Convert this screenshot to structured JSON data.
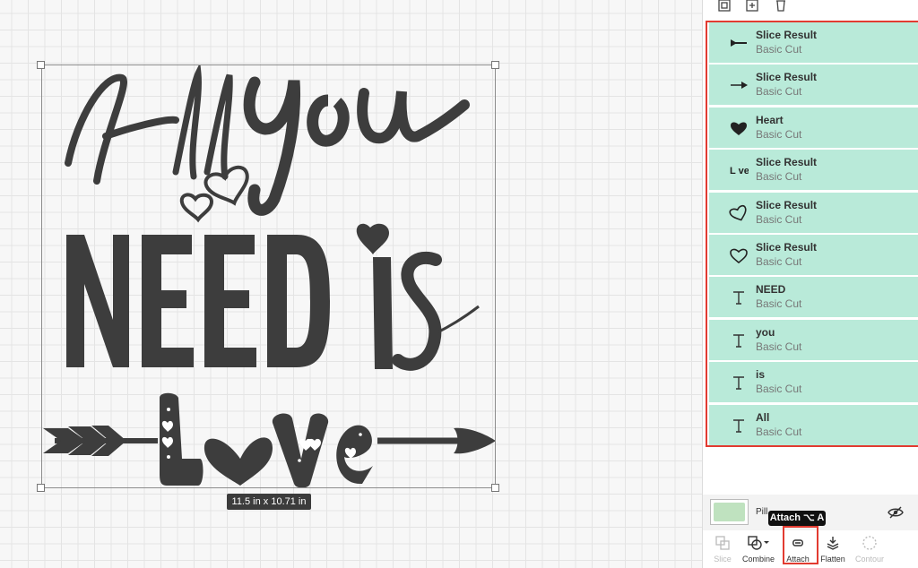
{
  "canvas": {
    "size_label": "11.5  in x 10.71  in"
  },
  "panel": {
    "top_tools": [
      {
        "icon": "group-icon"
      },
      {
        "icon": "duplicate-icon"
      },
      {
        "icon": "trash-icon"
      }
    ],
    "layers": [
      {
        "name": "Slice Result",
        "sub": "Basic Cut",
        "icon": "arrow-tail-icon"
      },
      {
        "name": "Slice Result",
        "sub": "Basic Cut",
        "icon": "arrow-head-icon"
      },
      {
        "name": "Heart",
        "sub": "Basic Cut",
        "icon": "heart-filled-icon"
      },
      {
        "name": "Slice Result",
        "sub": "Basic Cut",
        "icon": "love-text-icon"
      },
      {
        "name": "Slice Result",
        "sub": "Basic Cut",
        "icon": "heart-outline-left-icon"
      },
      {
        "name": "Slice Result",
        "sub": "Basic Cut",
        "icon": "heart-outline-icon"
      },
      {
        "name": "NEED",
        "sub": "Basic Cut",
        "icon": "text-icon"
      },
      {
        "name": "you",
        "sub": "Basic Cut",
        "icon": "text-icon"
      },
      {
        "name": "is",
        "sub": "Basic Cut",
        "icon": "text-icon"
      },
      {
        "name": "All",
        "sub": "Basic Cut",
        "icon": "text-icon"
      }
    ],
    "blank_canvas_label": "Pill",
    "tooltip": "Attach ⌥ A",
    "bottom_tools": {
      "slice": "Slice",
      "combine": "Combine",
      "attach": "Attach",
      "flatten": "Flatten",
      "contour": "Contour"
    }
  },
  "colors": {
    "layer_bg": "#b9ead9",
    "highlight": "#e23b31",
    "design_fill": "#3d3d3d"
  }
}
